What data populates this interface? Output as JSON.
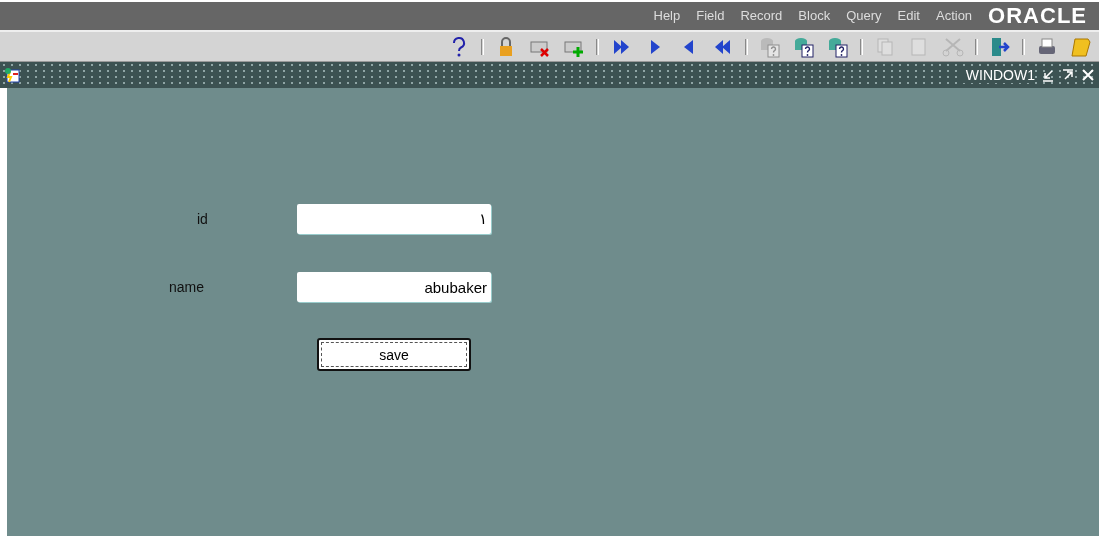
{
  "menu_bar": {
    "items": [
      "Help",
      "Field",
      "Record",
      "Block",
      "Query",
      "Edit",
      "Action"
    ],
    "logo": "ORACLE"
  },
  "toolbar": [
    {
      "kind": "help",
      "disabled": false
    },
    {
      "kind": "separator"
    },
    {
      "kind": "lock",
      "disabled": false
    },
    {
      "kind": "clear",
      "disabled": false
    },
    {
      "kind": "insert",
      "disabled": false
    },
    {
      "kind": "separator"
    },
    {
      "kind": "next-set",
      "disabled": false
    },
    {
      "kind": "next",
      "disabled": false
    },
    {
      "kind": "previous",
      "disabled": false
    },
    {
      "kind": "previous-set",
      "disabled": false
    },
    {
      "kind": "separator"
    },
    {
      "kind": "enter-query",
      "disabled": true
    },
    {
      "kind": "execute-query",
      "disabled": false
    },
    {
      "kind": "count-query",
      "disabled": false
    },
    {
      "kind": "separator"
    },
    {
      "kind": "copy",
      "disabled": true
    },
    {
      "kind": "paste",
      "disabled": true
    },
    {
      "kind": "cut",
      "disabled": true
    },
    {
      "kind": "separator"
    },
    {
      "kind": "exit",
      "disabled": false
    },
    {
      "kind": "separator"
    },
    {
      "kind": "print",
      "disabled": false
    },
    {
      "kind": "save",
      "disabled": false
    }
  ],
  "window": {
    "title": "WINDOW1"
  },
  "form": {
    "fields": [
      {
        "label": "id",
        "value": "١"
      },
      {
        "label": "name",
        "value": "abubaker"
      }
    ],
    "button": "save"
  }
}
